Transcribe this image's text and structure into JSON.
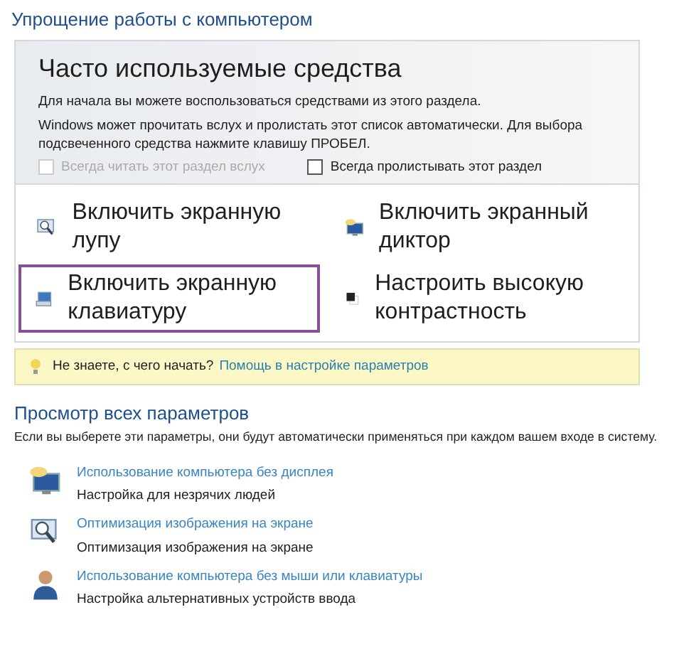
{
  "title": "Упрощение работы с компьютером",
  "common_tools": {
    "heading": "Часто используемые средства",
    "intro": "Для начала вы можете воспользоваться средствами из этого раздела.",
    "note": "Windows может прочитать вслух и пролистать этот список автоматически. Для выбора подсвеченного средства нажмите клавишу ПРОБЕЛ.",
    "checkboxes": [
      {
        "label": "Всегда читать этот раздел вслух",
        "checked": false,
        "disabled": true
      },
      {
        "label": "Всегда пролистывать этот раздел",
        "checked": false,
        "disabled": false
      }
    ],
    "tools": [
      {
        "kind": "magnifier",
        "label": "Включить экранную лупу",
        "selected": false
      },
      {
        "kind": "narrator",
        "label": "Включить экранный диктор",
        "selected": false
      },
      {
        "kind": "keyboard",
        "label": "Включить экранную клавиатуру",
        "selected": true
      },
      {
        "kind": "contrast",
        "label": "Настроить высокую контрастность",
        "selected": false
      }
    ]
  },
  "tip": {
    "text": "Не знаете, с чего начать?",
    "link": "Помощь в настройке параметров"
  },
  "all_settings": {
    "heading": "Просмотр всех параметров",
    "description": "Если вы выберете эти параметры, они будут автоматически применяться при каждом вашем входе в систему.",
    "items": [
      {
        "kind": "narrator",
        "link": "Использование компьютера без дисплея",
        "description": "Настройка для незрячих людей"
      },
      {
        "kind": "magnifier",
        "link": "Оптимизация изображения на экране",
        "description": "Оптимизация изображения на экране"
      },
      {
        "kind": "person",
        "link": "Использование компьютера без мыши или клавиатуры",
        "description": "Настройка альтернативных устройств ввода"
      }
    ]
  }
}
